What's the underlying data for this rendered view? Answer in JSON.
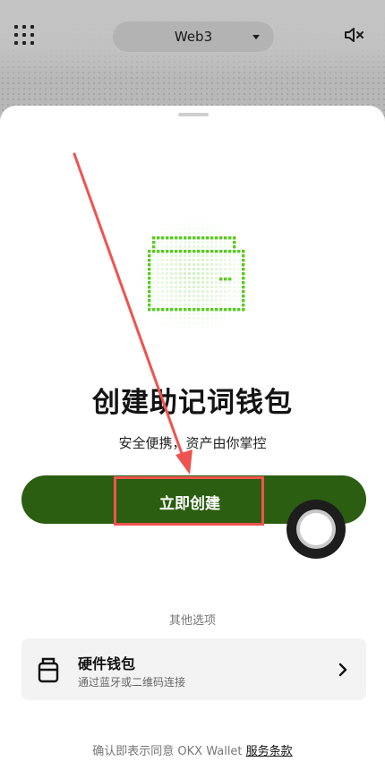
{
  "header": {
    "network_label": "Web3",
    "menu_icon": "grid-menu-icon",
    "sound_icon": "mute-icon"
  },
  "sheet": {
    "illustration": "wallet-icon",
    "title": "创建助记词钱包",
    "subtitle": "安全便携，资产由你掌控",
    "create_button": "立即创建",
    "other_options_label": "其他选项",
    "hardware": {
      "title": "硬件钱包",
      "subtitle": "通过蓝牙或二维码连接",
      "icon": "hardware-wallet-icon"
    },
    "footer_text": "确认即表示同意 OKX Wallet ",
    "footer_link": "服务条款"
  },
  "colors": {
    "brand_green": "#2b5e10",
    "annotation_red": "#ef5350",
    "pixel_green": "#56cc20"
  }
}
